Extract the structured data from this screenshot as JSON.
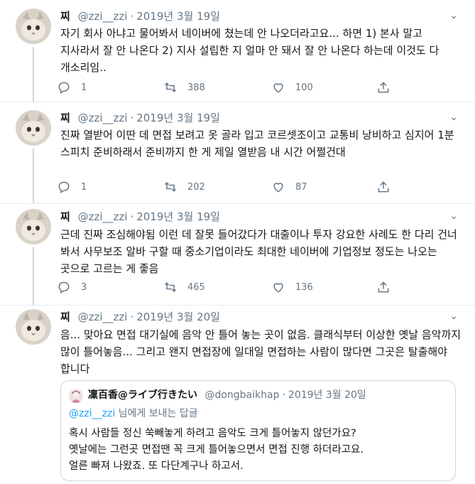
{
  "tweets": [
    {
      "name": "찌",
      "handle": "@zzi__zzi",
      "dot": "·",
      "date": "2019년 3월 19일",
      "text": "자기 회사 아냐고 물어봐서 네이버에 쳤는데 안 나오더라고요... 하면 1) 본사 말고 지사라서 잘 안 나온다 2) 지사 설립한 지 얼마 안 돼서 잘 안 나온다 하는데 이것도 다 개소리임..",
      "replies": "1",
      "retweets": "388",
      "likes": "100"
    },
    {
      "name": "찌",
      "handle": "@zzi__zzi",
      "dot": "·",
      "date": "2019년 3월 19일",
      "text": "진짜 열받어 이딴 데 면접 보려고 옷 골라 입고 코르셋조이고 교통비 낭비하고 심지어 1분 스피치 준비하래서 준비까지 한 게 제일 열받음 내 시간 어쩔건대",
      "replies": "1",
      "retweets": "202",
      "likes": "87"
    },
    {
      "name": "찌",
      "handle": "@zzi__zzi",
      "dot": "·",
      "date": "2019년 3월 19일",
      "text": "근데 진짜 조심해야됨 이런 데 잘못 들어갔다가 대출이나 투자 강요한 사례도 한 다리 건너 봐서 사무보조 알바 구할 때 중소기업이라도 최대한 네이버에 기업정보 정도는 나오는 곳으로 고르는 게 좋음",
      "replies": "3",
      "retweets": "465",
      "likes": "136"
    },
    {
      "name": "찌",
      "handle": "@zzi__zzi",
      "dot": "·",
      "date": "2019년 3월 20일",
      "text": "음... 맞아요 면접 대기실에 음악 안 틀어 놓는 곳이 없음. 클래식부터 이상한 옛날 음악까지 많이 틀어놓음... 그리고 왠지 면접장에 일대일 면접하는 사람이 많다면 그곳은 탈출해야 합니다"
    }
  ],
  "quote": {
    "name": "凜百香@ライブ行きたい",
    "handle": "@dongbaikhap",
    "dot": "·",
    "date": "2019년 3월 20일",
    "reply_mention": "@zzi__zzi",
    "reply_suffix": " 님에게 보내는 답글",
    "lines": [
      "혹시 사람들 정신 쑥빼놓게 하려고 음악도 크게 틀어놓지 않던가요?",
      "옛날에는 그런곳 면접땐 꼭 크게 틀어놓으면서 면접 진행 하더라고요.",
      "얼른 빠져 나왔죠. 또 다단계구나 하고서."
    ]
  },
  "icons": {
    "caret": "chevron-down-icon",
    "reply": "reply-icon",
    "retweet": "retweet-icon",
    "like": "heart-icon",
    "share": "share-icon"
  },
  "colors": {
    "text": "#14171a",
    "muted": "#657786",
    "link": "#1da1f2",
    "border": "#e6ecf0"
  }
}
